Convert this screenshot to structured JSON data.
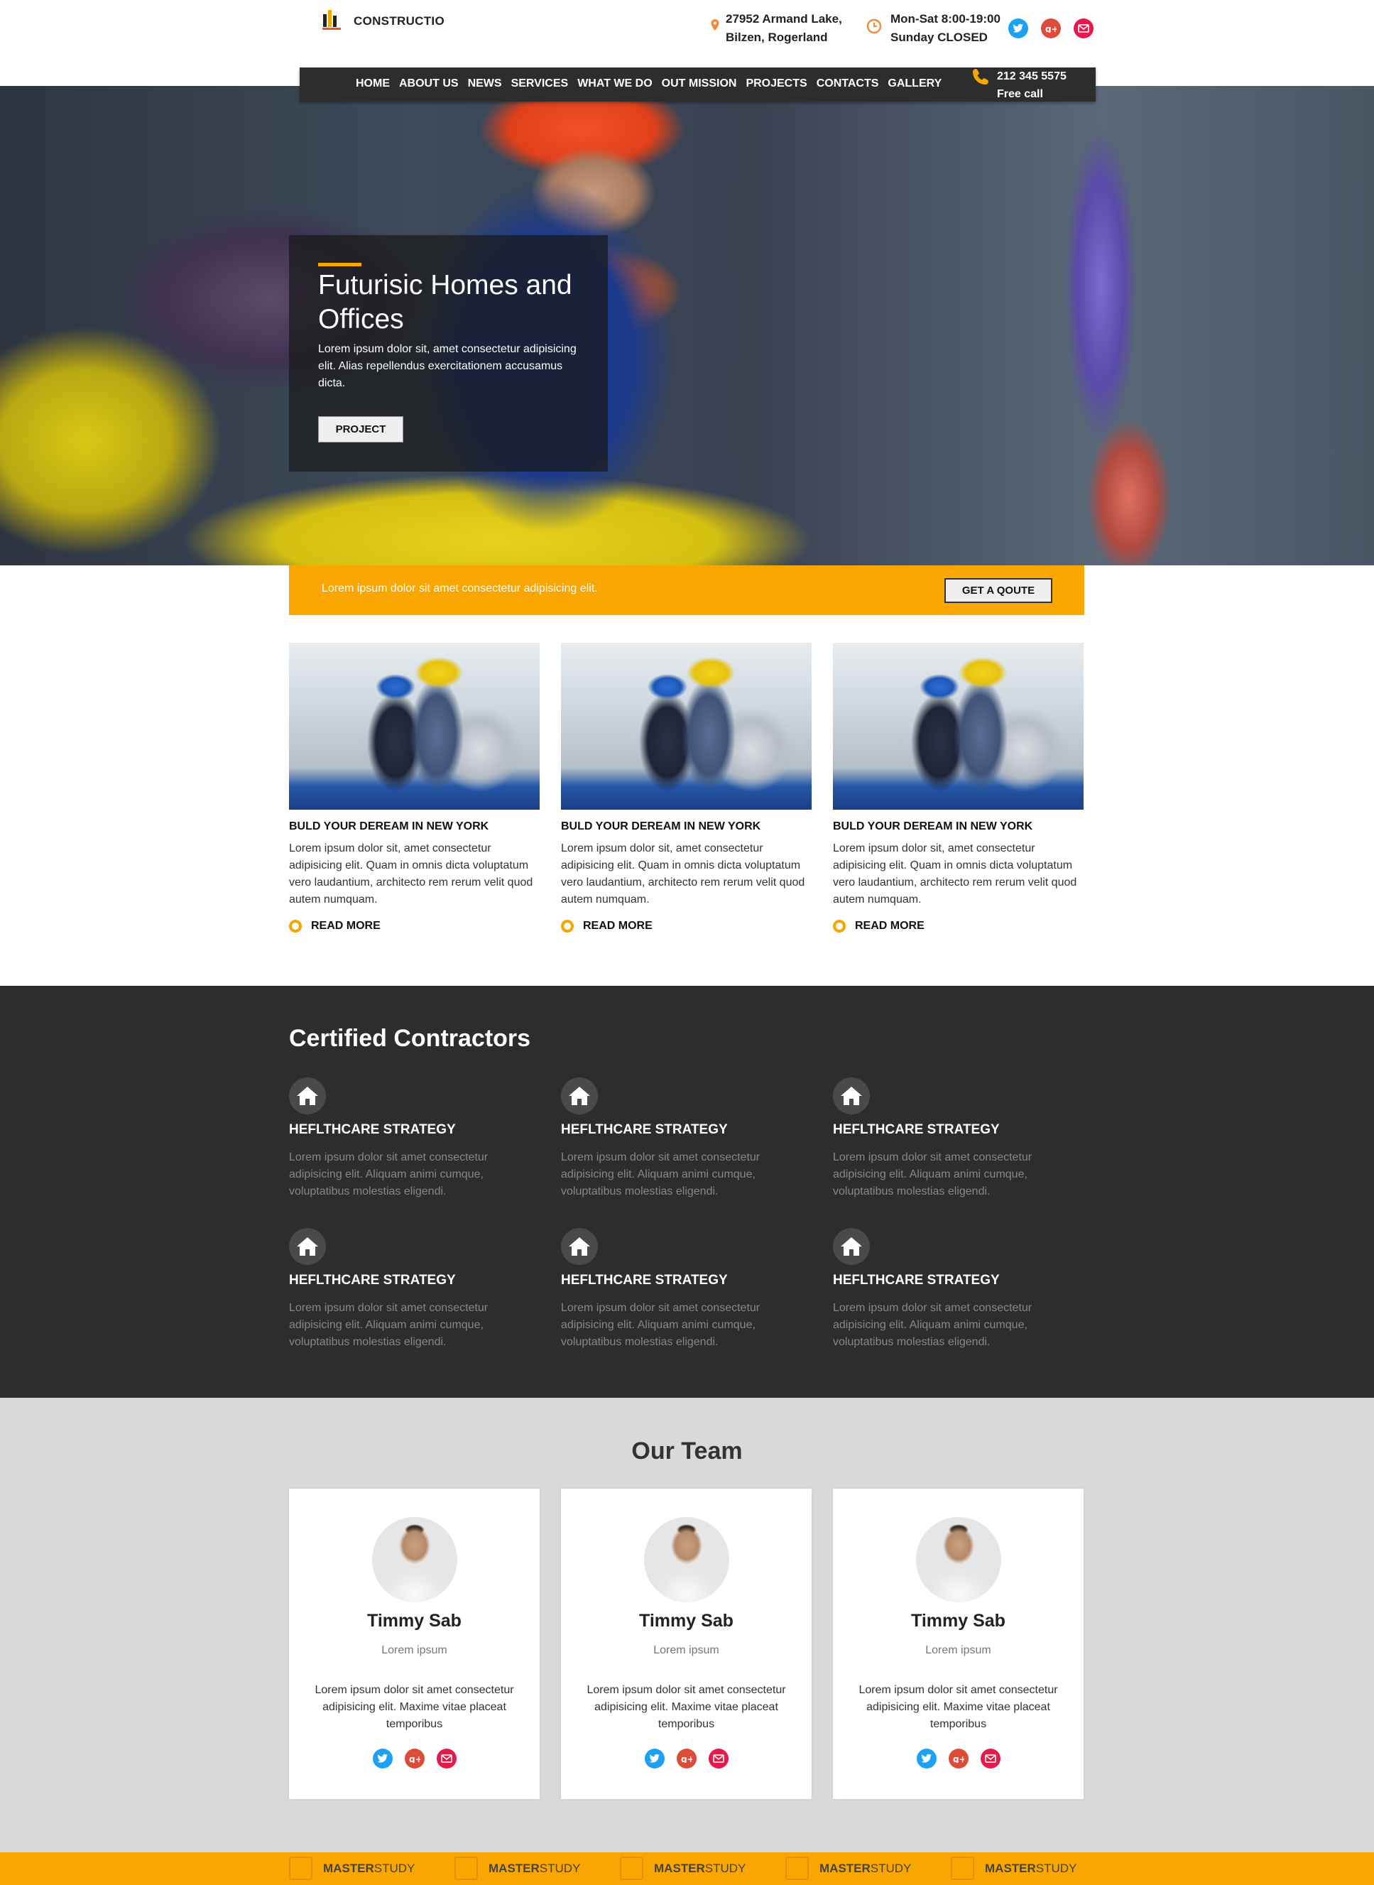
{
  "header": {
    "logo_text": "CONSTRUCTIO",
    "address_line1": "27952 Armand Lake,",
    "address_line2": "Bilzen, Rogerland",
    "hours_line1": "Mon-Sat 8:00-19:00",
    "hours_line2": "Sunday CLOSED"
  },
  "nav": {
    "items": [
      "HOME",
      "ABOUT US",
      "NEWS",
      "SERVICES",
      "WHAT WE DO",
      "OUT MISSION",
      "PROJECTS",
      "CONTACTS",
      "GALLERY"
    ],
    "phone": "212 345 5575",
    "phone_label": "Free call"
  },
  "hero": {
    "title": "Futurisic Homes and Offices",
    "text": "Lorem ipsum dolor sit, amet consectetur adipisicing elit. Alias repellendus exercitationem accusamus dicta.",
    "button": "PROJECT"
  },
  "quote_bar": {
    "text": "Lorem ipsum dolor sit amet consectetur adipisicing elit.",
    "button": "GET A QOUTE"
  },
  "cards": [
    {
      "title": "BULD YOUR DEREAM IN NEW YORK",
      "text": "Lorem ipsum dolor sit, amet consectetur adipisicing elit. Quam in omnis dicta voluptatum vero laudantium, architecto rem rerum velit quod autem numquam.",
      "link": "READ MORE"
    },
    {
      "title": "BULD YOUR DEREAM IN NEW YORK",
      "text": "Lorem ipsum dolor sit, amet consectetur adipisicing elit. Quam in omnis dicta voluptatum vero laudantium, architecto rem rerum velit quod autem numquam.",
      "link": "READ MORE"
    },
    {
      "title": "BULD YOUR DEREAM IN NEW YORK",
      "text": "Lorem ipsum dolor sit, amet consectetur adipisicing elit. Quam in omnis dicta voluptatum vero laudantium, architecto rem rerum velit quod autem numquam.",
      "link": "READ MORE"
    }
  ],
  "contractors": {
    "title": "Certified Contractors",
    "items": [
      {
        "title": "HEFLTHCARE STRATEGY",
        "text": "Lorem ipsum dolor sit amet consectetur adipisicing elit. Aliquam animi cumque, voluptatibus molestias eligendi."
      },
      {
        "title": "HEFLTHCARE STRATEGY",
        "text": "Lorem ipsum dolor sit amet consectetur adipisicing elit. Aliquam animi cumque, voluptatibus molestias eligendi."
      },
      {
        "title": "HEFLTHCARE STRATEGY",
        "text": "Lorem ipsum dolor sit amet consectetur adipisicing elit. Aliquam animi cumque, voluptatibus molestias eligendi."
      },
      {
        "title": "HEFLTHCARE STRATEGY",
        "text": "Lorem ipsum dolor sit amet consectetur adipisicing elit. Aliquam animi cumque, voluptatibus molestias eligendi."
      },
      {
        "title": "HEFLTHCARE STRATEGY",
        "text": "Lorem ipsum dolor sit amet consectetur adipisicing elit. Aliquam animi cumque, voluptatibus molestias eligendi."
      },
      {
        "title": "HEFLTHCARE STRATEGY",
        "text": "Lorem ipsum dolor sit amet consectetur adipisicing elit. Aliquam animi cumque, voluptatibus molestias eligendi."
      }
    ]
  },
  "team": {
    "title": "Our Team",
    "members": [
      {
        "name": "Timmy Sab",
        "role": "Lorem ipsum",
        "text": "Lorem ipsum dolor sit amet consectetur adipisicing elit. Maxime vitae placeat temporibus"
      },
      {
        "name": "Timmy Sab",
        "role": "Lorem ipsum",
        "text": "Lorem ipsum dolor sit amet consectetur adipisicing elit. Maxime vitae placeat temporibus"
      },
      {
        "name": "Timmy Sab",
        "role": "Lorem ipsum",
        "text": "Lorem ipsum dolor sit amet consectetur adipisicing elit. Maxime vitae placeat temporibus"
      }
    ]
  },
  "footer": {
    "brands": [
      {
        "bold": "MASTER",
        "light": "STUDY"
      },
      {
        "bold": "MASTER",
        "light": "STUDY"
      },
      {
        "bold": "MASTER",
        "light": "STUDY"
      },
      {
        "bold": "MASTER",
        "light": "STUDY"
      },
      {
        "bold": "MASTER",
        "light": "STUDY"
      }
    ]
  },
  "icons": [
    "logo-icon",
    "location-pin-icon",
    "clock-icon",
    "twitter-icon",
    "google-plus-icon",
    "mail-icon",
    "phone-icon",
    "home-icon",
    "master-study-logo-icon"
  ],
  "colors": {
    "accent": "#f9a602",
    "dark": "#2d2d2d",
    "twitter": "#1da1f2",
    "google_plus": "#dd4b39",
    "mail": "#e5194b",
    "team_bg": "#d9d9d9"
  }
}
